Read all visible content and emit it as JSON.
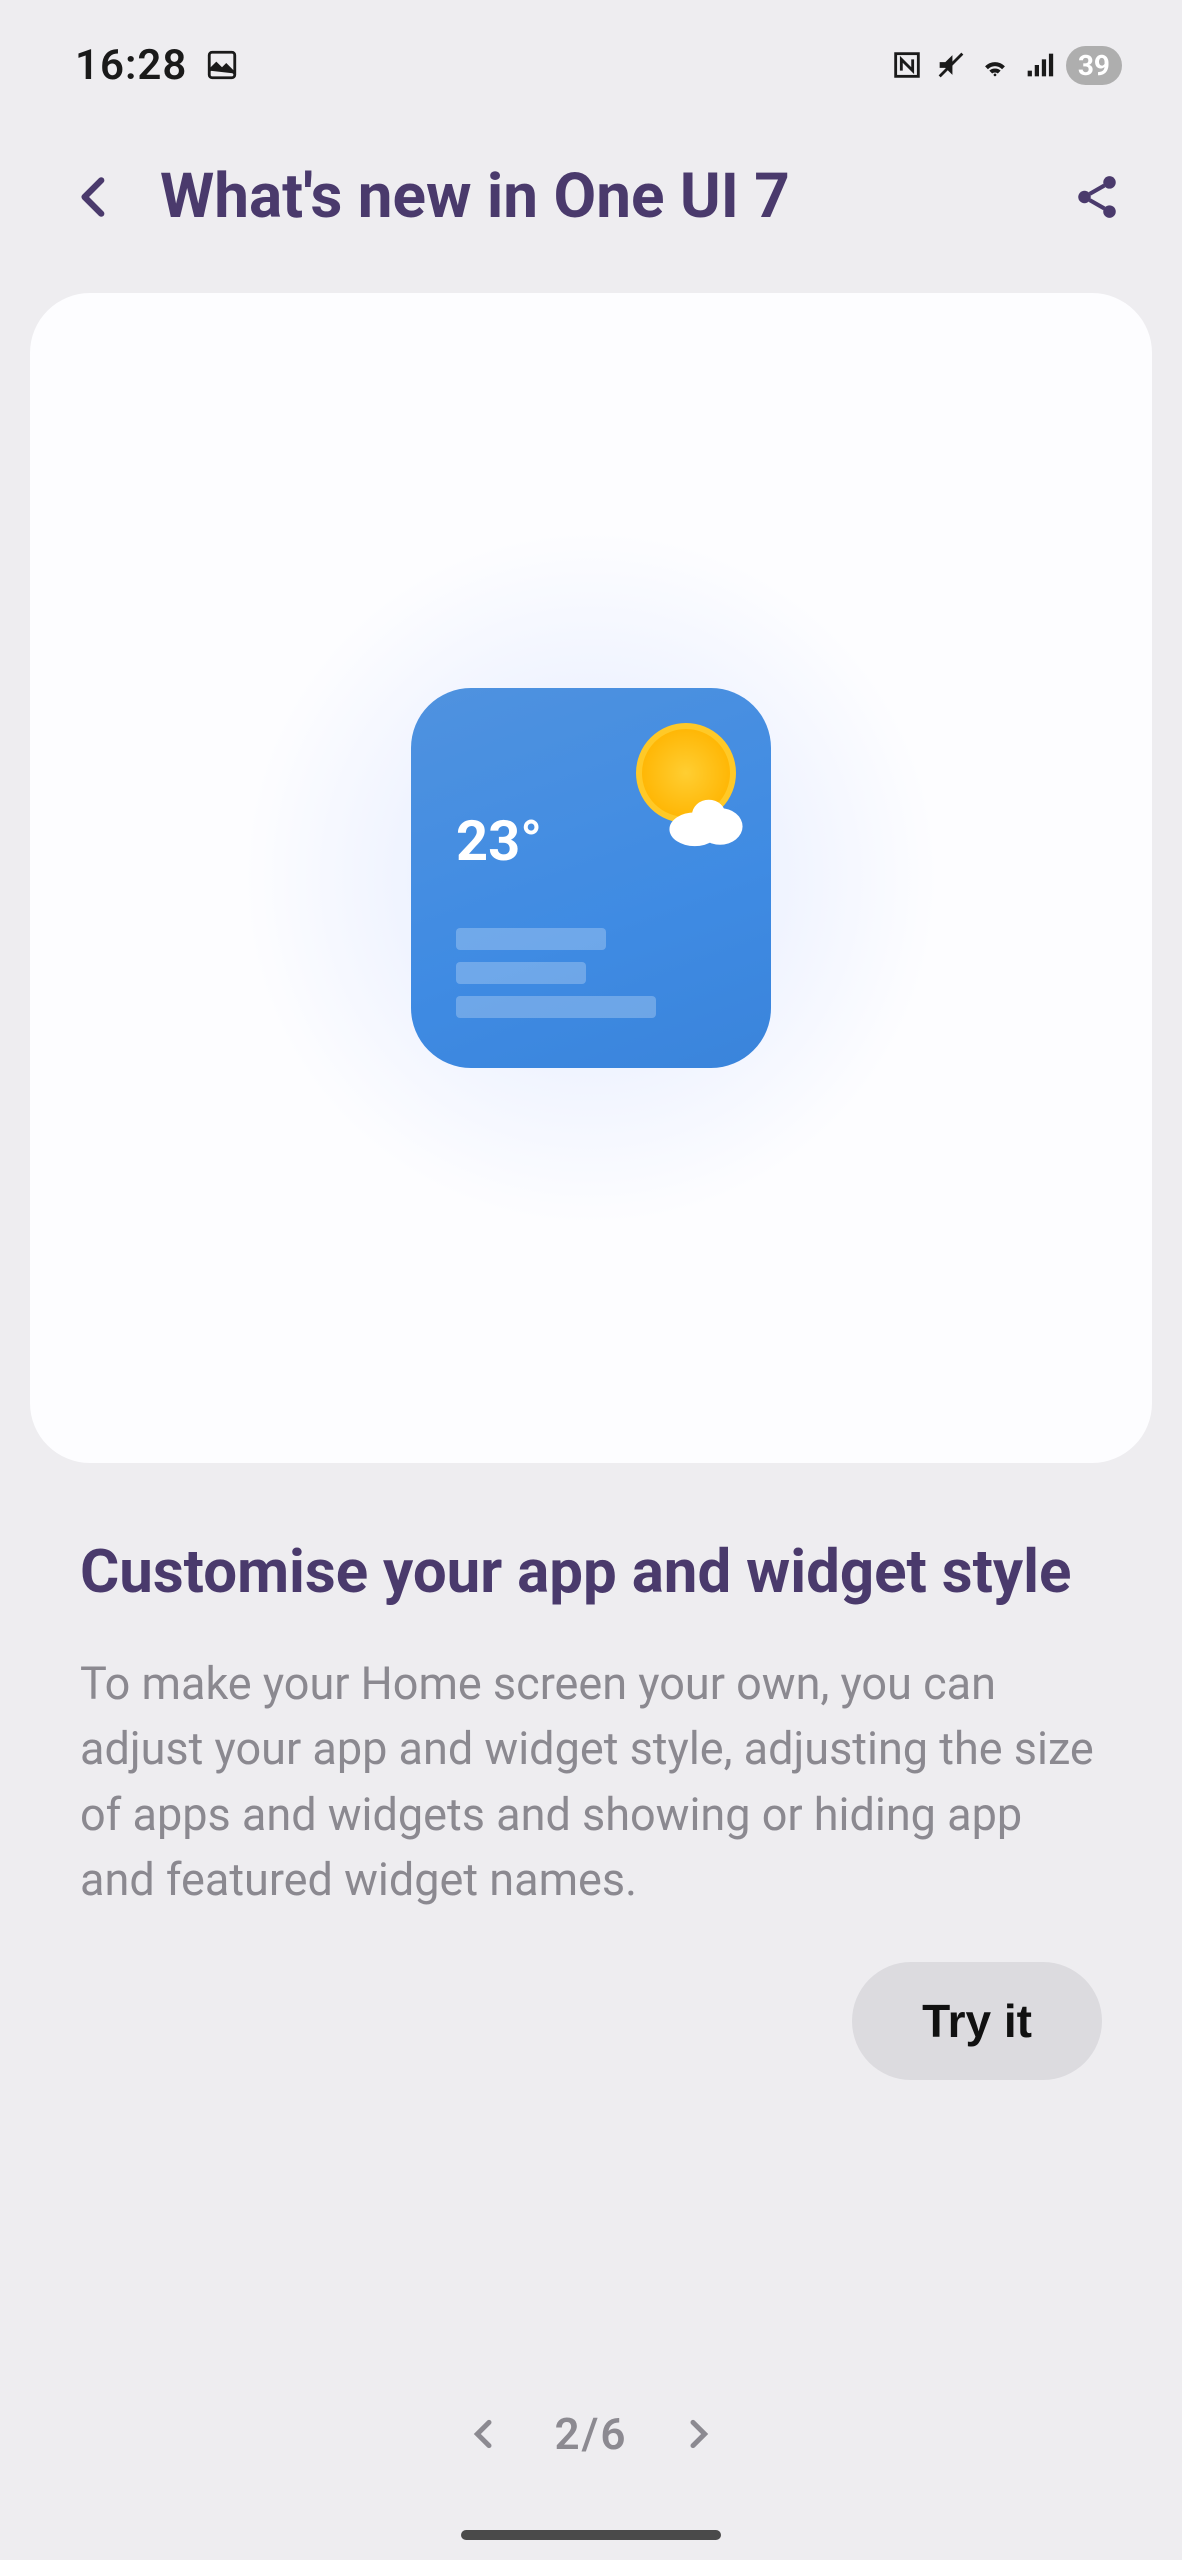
{
  "status": {
    "time": "16:28",
    "battery": "39"
  },
  "header": {
    "title": "What's new in One UI 7"
  },
  "card": {
    "weather_temp": "23°"
  },
  "content": {
    "title": "Customise your app and widget style",
    "description": "To make your Home screen your own, you can adjust your app and widget style, adjusting the size of apps and widgets and showing or hiding app and featured widget names.",
    "try_button": "Try it"
  },
  "pager": {
    "current": 2,
    "total": 6,
    "label": "2/6"
  }
}
